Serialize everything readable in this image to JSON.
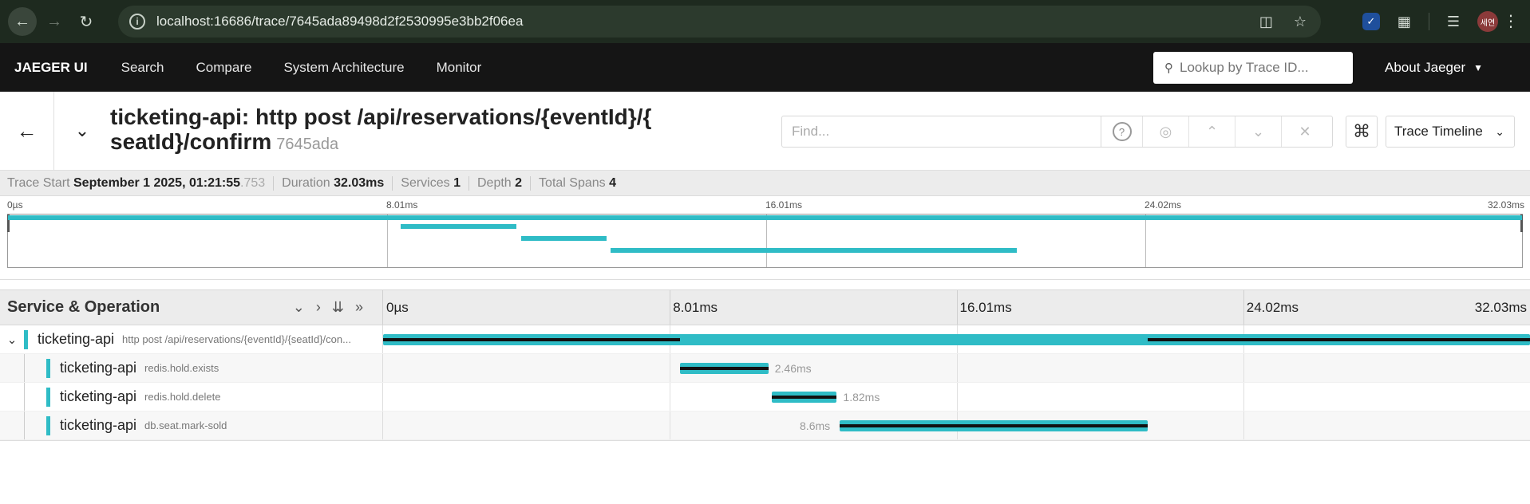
{
  "browser": {
    "url": "localhost:16686/trace/7645ada89498d2f2530995e3bb2f06ea",
    "profile_label": "세연"
  },
  "nav": {
    "brand": "JAEGER UI",
    "items": [
      "Search",
      "Compare",
      "System Architecture",
      "Monitor"
    ],
    "lookup_placeholder": "Lookup by Trace ID...",
    "about": "About Jaeger"
  },
  "trace": {
    "title_line1": "ticketing-api: http post /api/reservations/{eventId}/{",
    "title_line2": "seatId}/confirm",
    "trace_id_short": "7645ada",
    "find_placeholder": "Find...",
    "view_mode": "Trace Timeline"
  },
  "summary": {
    "trace_start_label": "Trace Start",
    "trace_start_value": "September 1 2025, 01:21:55",
    "trace_start_ms": ".753",
    "duration_label": "Duration",
    "duration_value": "32.03ms",
    "services_label": "Services",
    "services_value": "1",
    "depth_label": "Depth",
    "depth_value": "2",
    "total_spans_label": "Total Spans",
    "total_spans_value": "4"
  },
  "timeline": {
    "ticks": [
      "0µs",
      "8.01ms",
      "16.01ms",
      "24.02ms",
      "32.03ms"
    ],
    "header_label": "Service & Operation",
    "total_ms": 32.03,
    "spans": [
      {
        "service": "ticketing-api",
        "operation": "http post /api/reservations/{eventId}/{seatId}/con...",
        "start_ms": 0,
        "duration_ms": 32.03,
        "depth": 0,
        "label": ""
      },
      {
        "service": "ticketing-api",
        "operation": "redis.hold.exists",
        "start_ms": 8.3,
        "duration_ms": 2.46,
        "depth": 1,
        "label": "2.46ms"
      },
      {
        "service": "ticketing-api",
        "operation": "redis.hold.delete",
        "start_ms": 10.85,
        "duration_ms": 1.82,
        "depth": 1,
        "label": "1.82ms"
      },
      {
        "service": "ticketing-api",
        "operation": "db.seat.mark-sold",
        "start_ms": 12.75,
        "duration_ms": 8.6,
        "depth": 1,
        "label": "8.6ms"
      }
    ]
  },
  "colors": {
    "span": "#2fbcc6",
    "critical_path": "#111111"
  }
}
